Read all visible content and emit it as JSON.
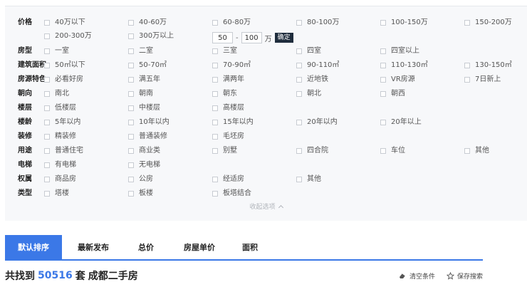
{
  "filters": [
    {
      "label": "价格",
      "options": [
        "40万以下",
        "40-60万",
        "60-80万",
        "80-100万",
        "100-150万",
        "150-200万",
        "200-300万",
        "300万以上"
      ]
    },
    {
      "label": "房型",
      "options": [
        "一室",
        "二室",
        "三室",
        "四室",
        "四室以上"
      ]
    },
    {
      "label": "建筑面积",
      "options": [
        "50㎡以下",
        "50-70㎡",
        "70-90㎡",
        "90-110㎡",
        "110-130㎡",
        "130-150㎡"
      ]
    },
    {
      "label": "房源特色",
      "options": [
        "必看好房",
        "满五年",
        "满两年",
        "近地铁",
        "VR房源",
        "7日新上"
      ]
    },
    {
      "label": "朝向",
      "options": [
        "南北",
        "朝南",
        "朝东",
        "朝北",
        "朝西"
      ]
    },
    {
      "label": "楼层",
      "options": [
        "低楼层",
        "中楼层",
        "高楼层"
      ]
    },
    {
      "label": "楼龄",
      "options": [
        "5年以内",
        "10年以内",
        "15年以内",
        "20年以内",
        "20年以上"
      ]
    },
    {
      "label": "装修",
      "options": [
        "精装修",
        "普通装修",
        "毛坯房"
      ]
    },
    {
      "label": "用途",
      "options": [
        "普通住宅",
        "商业类",
        "别墅",
        "四合院",
        "车位",
        "其他"
      ]
    },
    {
      "label": "电梯",
      "options": [
        "有电梯",
        "无电梯"
      ]
    },
    {
      "label": "权属",
      "options": [
        "商品房",
        "公房",
        "经适房",
        "其他"
      ]
    },
    {
      "label": "类型",
      "options": [
        "塔楼",
        "板楼",
        "板塔结合"
      ]
    }
  ],
  "price_range": {
    "min": "50",
    "max": "100",
    "dash": "-",
    "unit": "万",
    "confirm": "确定"
  },
  "collapse_label": "收起选项",
  "sort_tabs": [
    "默认排序",
    "最新发布",
    "总价",
    "房屋单价",
    "面积"
  ],
  "result": {
    "prefix": "共找到",
    "count": "50516",
    "suffix": "套",
    "city": "成都二手房"
  },
  "tools": {
    "clear": "清空条件",
    "save": "保存搜索"
  },
  "colors": {
    "accent": "#3b78e7",
    "confirm_bg": "#1f2d3d",
    "panel_bg": "#f7f8fa"
  },
  "icons": {
    "clear": "eraser-icon",
    "save": "star-outline-icon",
    "collapse": "chevron-up-icon"
  }
}
